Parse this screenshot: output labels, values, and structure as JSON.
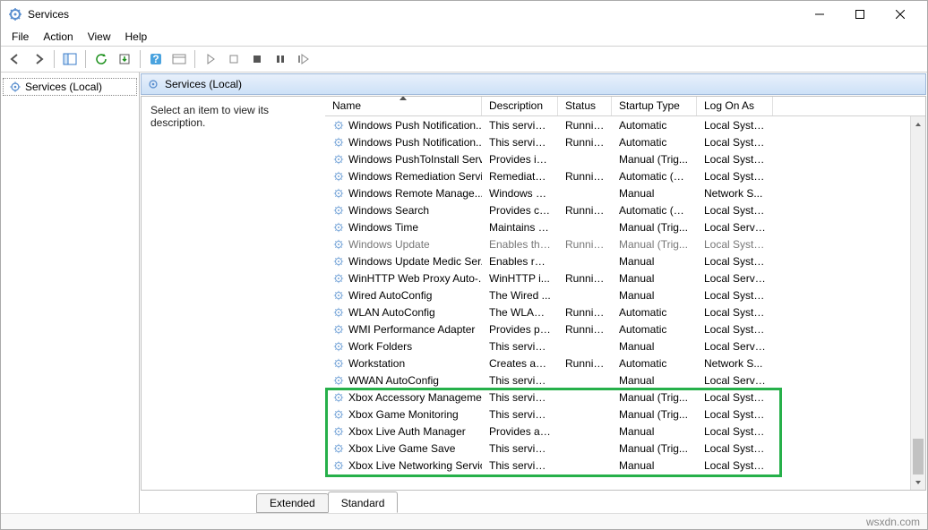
{
  "window": {
    "title": "Services"
  },
  "menu": {
    "items": [
      "File",
      "Action",
      "View",
      "Help"
    ]
  },
  "tree": {
    "root": "Services (Local)"
  },
  "header": {
    "title": "Services (Local)"
  },
  "desc": {
    "prompt": "Select an item to view its description."
  },
  "columns": {
    "name": "Name",
    "description": "Description",
    "status": "Status",
    "startup": "Startup Type",
    "logon": "Log On As"
  },
  "tabs": {
    "extended": "Extended",
    "standard": "Standard"
  },
  "footer": {
    "credit": "wsxdn.com"
  },
  "services": [
    {
      "name": "Windows Push Notification...",
      "desc": "This service ...",
      "status": "Running",
      "startup": "Automatic",
      "logon": "Local Syste..."
    },
    {
      "name": "Windows Push Notification...",
      "desc": "This service ...",
      "status": "Running",
      "startup": "Automatic",
      "logon": "Local Syste..."
    },
    {
      "name": "Windows PushToInstall Serv...",
      "desc": "Provides inf...",
      "status": "",
      "startup": "Manual (Trig...",
      "logon": "Local Syste..."
    },
    {
      "name": "Windows Remediation Servi...",
      "desc": "Remediates ...",
      "status": "Running",
      "startup": "Automatic (D...",
      "logon": "Local Syste..."
    },
    {
      "name": "Windows Remote Manage...",
      "desc": "Windows R...",
      "status": "",
      "startup": "Manual",
      "logon": "Network S..."
    },
    {
      "name": "Windows Search",
      "desc": "Provides co...",
      "status": "Running",
      "startup": "Automatic (D...",
      "logon": "Local Syste..."
    },
    {
      "name": "Windows Time",
      "desc": "Maintains d...",
      "status": "",
      "startup": "Manual (Trig...",
      "logon": "Local Service"
    },
    {
      "name": "Windows Update",
      "desc": "Enables the ...",
      "status": "Running",
      "startup": "Manual (Trig...",
      "logon": "Local Syste...",
      "dimmed": true
    },
    {
      "name": "Windows Update Medic Ser...",
      "desc": "Enables rem...",
      "status": "",
      "startup": "Manual",
      "logon": "Local Syste..."
    },
    {
      "name": "WinHTTP Web Proxy Auto-...",
      "desc": "WinHTTP i...",
      "status": "Running",
      "startup": "Manual",
      "logon": "Local Service"
    },
    {
      "name": "Wired AutoConfig",
      "desc": "The Wired ...",
      "status": "",
      "startup": "Manual",
      "logon": "Local Syste..."
    },
    {
      "name": "WLAN AutoConfig",
      "desc": "The WLANS...",
      "status": "Running",
      "startup": "Automatic",
      "logon": "Local Syste..."
    },
    {
      "name": "WMI Performance Adapter",
      "desc": "Provides pe...",
      "status": "Running",
      "startup": "Automatic",
      "logon": "Local Syste..."
    },
    {
      "name": "Work Folders",
      "desc": "This service ...",
      "status": "",
      "startup": "Manual",
      "logon": "Local Service"
    },
    {
      "name": "Workstation",
      "desc": "Creates and...",
      "status": "Running",
      "startup": "Automatic",
      "logon": "Network S..."
    },
    {
      "name": "WWAN AutoConfig",
      "desc": "This service ...",
      "status": "",
      "startup": "Manual",
      "logon": "Local Service"
    },
    {
      "name": "Xbox Accessory Manageme...",
      "desc": "This service ...",
      "status": "",
      "startup": "Manual (Trig...",
      "logon": "Local Syste..."
    },
    {
      "name": "Xbox Game Monitoring",
      "desc": "This service ...",
      "status": "",
      "startup": "Manual (Trig...",
      "logon": "Local Syste..."
    },
    {
      "name": "Xbox Live Auth Manager",
      "desc": "Provides au...",
      "status": "",
      "startup": "Manual",
      "logon": "Local Syste..."
    },
    {
      "name": "Xbox Live Game Save",
      "desc": "This service ...",
      "status": "",
      "startup": "Manual (Trig...",
      "logon": "Local Syste..."
    },
    {
      "name": "Xbox Live Networking Service",
      "desc": "This service ...",
      "status": "",
      "startup": "Manual",
      "logon": "Local Syste..."
    }
  ]
}
